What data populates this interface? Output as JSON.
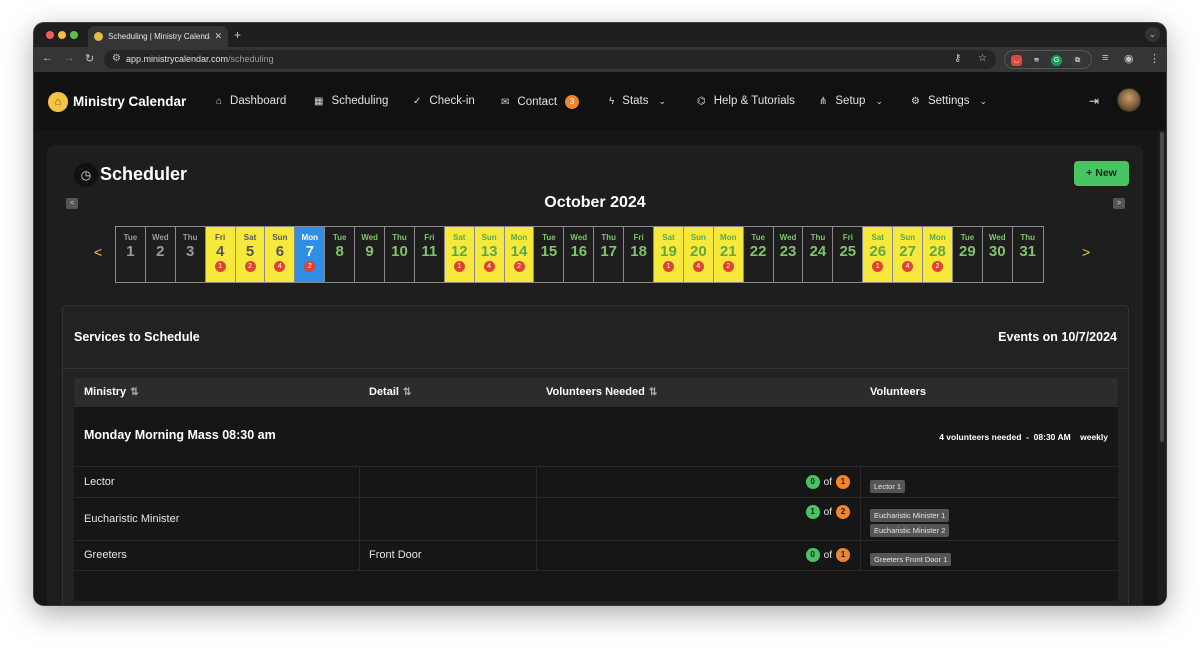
{
  "browser": {
    "tab_title": "Scheduling | Ministry Calendar",
    "url_domain": "app.ministrycalendar.com",
    "url_path": "/scheduling"
  },
  "nav": {
    "brand": "Ministry Calendar",
    "items": [
      {
        "label": "Dashboard",
        "icon": "home-icon"
      },
      {
        "label": "Scheduling",
        "icon": "calendar-icon"
      },
      {
        "label": "Check-in",
        "icon": "check-circle-icon"
      },
      {
        "label": "Contact",
        "icon": "mail-icon",
        "badge": "3"
      },
      {
        "label": "Stats",
        "icon": "bolt-icon",
        "dropdown": true
      },
      {
        "label": "Help & Tutorials",
        "icon": "cap-icon"
      },
      {
        "label": "Setup",
        "icon": "sitemap-icon",
        "dropdown": true
      },
      {
        "label": "Settings",
        "icon": "gear-icon",
        "dropdown": true
      }
    ]
  },
  "page": {
    "title": "Scheduler",
    "new_button": "New",
    "prev_small": "<",
    "next_small": ">",
    "month": "October 2024",
    "prev_arrow": "<",
    "next_arrow": ">"
  },
  "calendar": [
    {
      "dow": "Tue",
      "day": "1",
      "style": "muted"
    },
    {
      "dow": "Wed",
      "day": "2",
      "style": "muted"
    },
    {
      "dow": "Thu",
      "day": "3",
      "style": "muted"
    },
    {
      "dow": "Fri",
      "day": "4",
      "style": "yellow",
      "count": "1"
    },
    {
      "dow": "Sat",
      "day": "5",
      "style": "yellow",
      "count": "2"
    },
    {
      "dow": "Sun",
      "day": "6",
      "style": "yellow",
      "count": "4"
    },
    {
      "dow": "Mon",
      "day": "7",
      "style": "today",
      "count": "2"
    },
    {
      "dow": "Tue",
      "day": "8",
      "style": "plain"
    },
    {
      "dow": "Wed",
      "day": "9",
      "style": "plain"
    },
    {
      "dow": "Thu",
      "day": "10",
      "style": "plain"
    },
    {
      "dow": "Fri",
      "day": "11",
      "style": "plain"
    },
    {
      "dow": "Sat",
      "day": "12",
      "style": "yellow future",
      "count": "1"
    },
    {
      "dow": "Sun",
      "day": "13",
      "style": "yellow future",
      "count": "4"
    },
    {
      "dow": "Mon",
      "day": "14",
      "style": "yellow future",
      "count": "2"
    },
    {
      "dow": "Tue",
      "day": "15",
      "style": "plain"
    },
    {
      "dow": "Wed",
      "day": "16",
      "style": "plain"
    },
    {
      "dow": "Thu",
      "day": "17",
      "style": "plain"
    },
    {
      "dow": "Fri",
      "day": "18",
      "style": "plain"
    },
    {
      "dow": "Sat",
      "day": "19",
      "style": "yellow future",
      "count": "1"
    },
    {
      "dow": "Sun",
      "day": "20",
      "style": "yellow future",
      "count": "4"
    },
    {
      "dow": "Mon",
      "day": "21",
      "style": "yellow future",
      "count": "2"
    },
    {
      "dow": "Tue",
      "day": "22",
      "style": "plain"
    },
    {
      "dow": "Wed",
      "day": "23",
      "style": "plain"
    },
    {
      "dow": "Thu",
      "day": "24",
      "style": "plain"
    },
    {
      "dow": "Fri",
      "day": "25",
      "style": "plain"
    },
    {
      "dow": "Sat",
      "day": "26",
      "style": "yellow future",
      "count": "1"
    },
    {
      "dow": "Sun",
      "day": "27",
      "style": "yellow future",
      "count": "4"
    },
    {
      "dow": "Mon",
      "day": "28",
      "style": "yellow future",
      "count": "2"
    },
    {
      "dow": "Tue",
      "day": "29",
      "style": "plain"
    },
    {
      "dow": "Wed",
      "day": "30",
      "style": "plain"
    },
    {
      "dow": "Thu",
      "day": "31",
      "style": "plain"
    }
  ],
  "services": {
    "heading": "Services to Schedule",
    "events_label": "Events on 10/7/2024",
    "columns": [
      "Ministry",
      "Detail",
      "Volunteers Needed",
      "Volunteers"
    ],
    "service": {
      "name": "Monday Morning Mass 08:30 am",
      "meta": "4 volunteers needed  -  08:30 AM    weekly"
    },
    "rows": [
      {
        "ministry": "Lector",
        "detail": "",
        "filled": "0",
        "needed": "1",
        "of": "of",
        "volunteers": [
          "Lector 1"
        ]
      },
      {
        "ministry": "Eucharistic Minister",
        "detail": "",
        "filled": "1",
        "needed": "2",
        "of": "of",
        "volunteers": [
          "Eucharistic Minister 1",
          "Eucharistic Minister 2"
        ]
      },
      {
        "ministry": "Greeters",
        "detail": "Front Door",
        "filled": "0",
        "needed": "1",
        "of": "of",
        "volunteers": [
          "Greeters Front Door 1"
        ]
      }
    ]
  }
}
